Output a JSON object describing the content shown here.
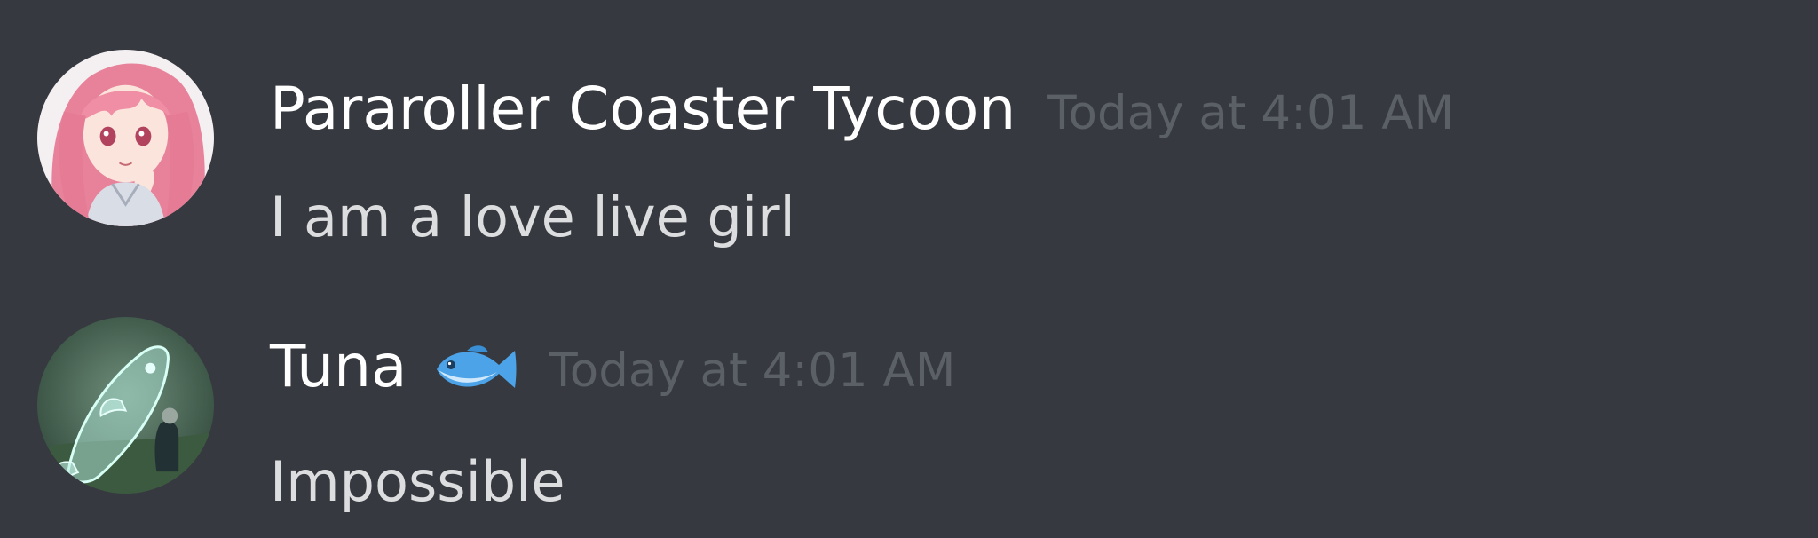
{
  "messages": [
    {
      "username": "Pararoller Coaster Tycoon",
      "timestamp": "Today at 4:01 AM",
      "text": "I am a love live girl",
      "avatar_icon": "anime-girl-avatar"
    },
    {
      "username": "Tuna",
      "username_emoji": "fish-emoji",
      "timestamp": "Today at 4:01 AM",
      "text": "Impossible",
      "avatar_icon": "ghost-fish-avatar"
    }
  ],
  "colors": {
    "background": "#36393f",
    "username": "#ffffff",
    "timestamp": "#5b5f66",
    "message_text": "#dcddde"
  }
}
